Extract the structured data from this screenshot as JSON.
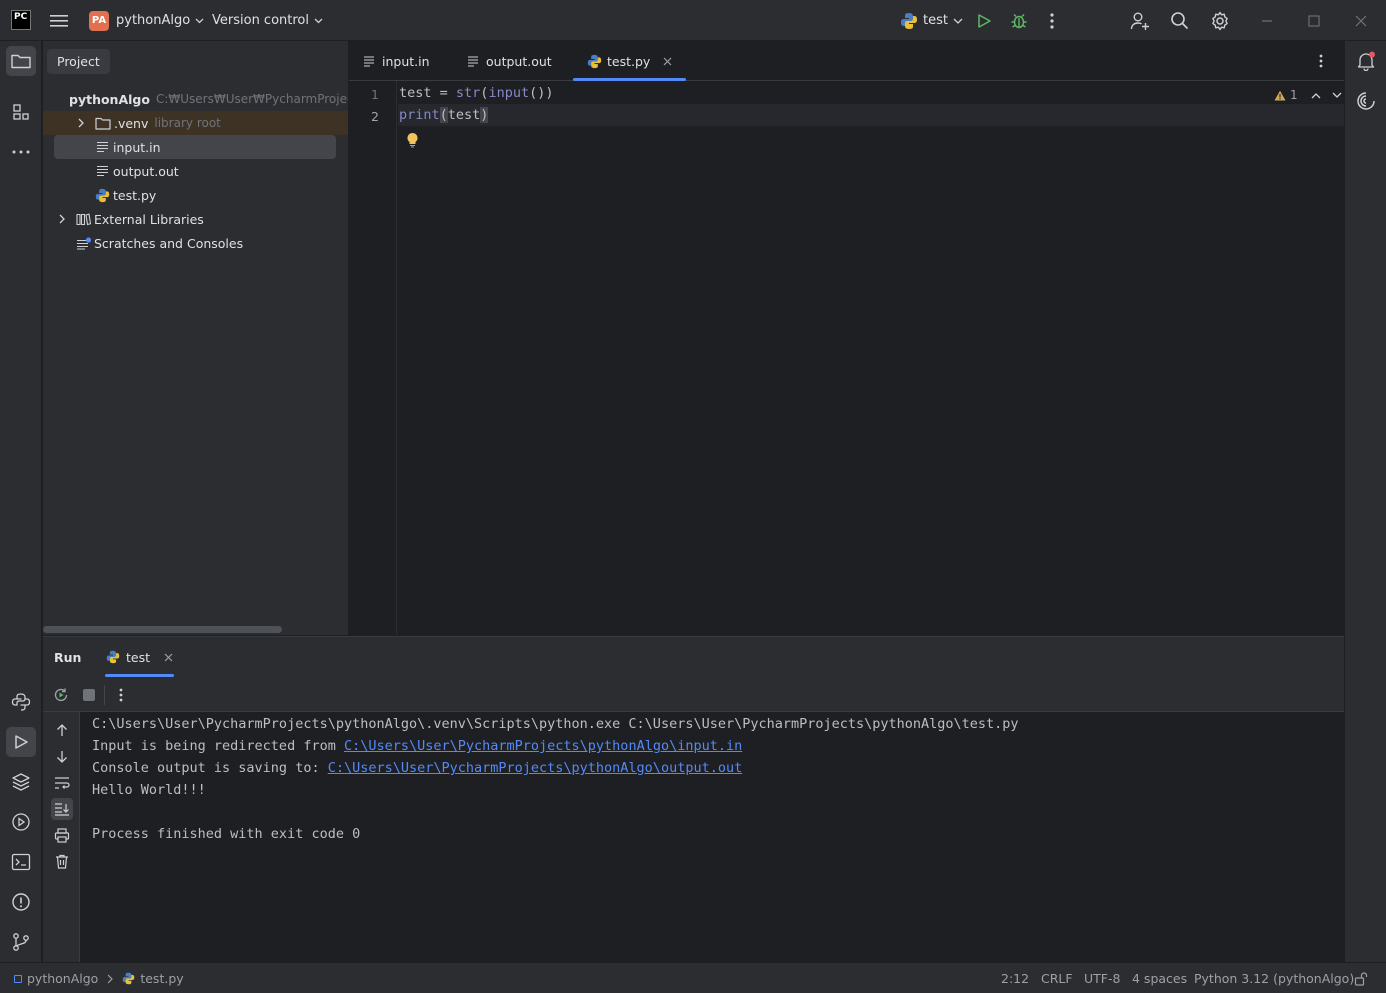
{
  "titlebar": {
    "logo": "PC",
    "project_badge": "PA",
    "project_name": "pythonAlgo",
    "vcs_label": "Version control",
    "run_config": "test",
    "icons": [
      "hamburger-menu-icon",
      "run-icon",
      "debug-icon",
      "more-icon",
      "add-user-icon",
      "search-icon",
      "settings-icon",
      "minimize-icon",
      "maximize-icon",
      "close-icon"
    ]
  },
  "project_panel": {
    "tab_label": "Project",
    "tree": [
      {
        "label": "pythonAlgo",
        "hint": "C:₩Users₩User₩PycharmProjects₩",
        "type": "folder",
        "expanded": true
      },
      {
        "label": ".venv",
        "hint": "library root",
        "type": "folder",
        "expanded": false
      },
      {
        "label": "input.in",
        "hint": "",
        "type": "text-file",
        "selected": true
      },
      {
        "label": "output.out",
        "hint": "",
        "type": "text-file"
      },
      {
        "label": "test.py",
        "hint": "",
        "type": "python-file"
      },
      {
        "label": "External Libraries",
        "hint": "",
        "type": "library"
      },
      {
        "label": "Scratches and Consoles",
        "hint": "",
        "type": "scratches"
      }
    ]
  },
  "editor": {
    "tabs": [
      {
        "label": "input.in",
        "active": false
      },
      {
        "label": "output.out",
        "active": false
      },
      {
        "label": "test.py",
        "active": true
      }
    ],
    "warning_count": "1",
    "line_numbers": [
      "1",
      "2"
    ],
    "lines": [
      {
        "id": "test",
        "sp1": " = ",
        "fn1": "str",
        "p1": "(",
        "fn2": "input",
        "p2": "())"
      },
      {
        "fn1": "print",
        "p1": "(",
        "id": "test",
        "p2": ")"
      }
    ]
  },
  "run_panel": {
    "title": "Run",
    "tab_label": "test",
    "console": {
      "line1": "C:\\Users\\User\\PycharmProjects\\pythonAlgo\\.venv\\Scripts\\python.exe C:\\Users\\User\\PycharmProjects\\pythonAlgo\\test.py",
      "line2_prefix": "Input is being redirected from ",
      "line2_link": "C:\\Users\\User\\PycharmProjects\\pythonAlgo\\input.in",
      "line3_prefix": "Console output is saving to: ",
      "line3_link": "C:\\Users\\User\\PycharmProjects\\pythonAlgo\\output.out",
      "line4": "Hello World!!!",
      "line6": "Process finished with exit code 0"
    }
  },
  "statusbar": {
    "breadcrumb_project": "pythonAlgo",
    "breadcrumb_file": "test.py",
    "position": "2:12",
    "line_separator": "CRLF",
    "encoding": "UTF-8",
    "indent": "4 spaces",
    "interpreter": "Python 3.12 (pythonAlgo)"
  },
  "colors": {
    "background": "#1e1f22",
    "panel": "#2b2d30",
    "accent": "#548af7",
    "run_green": "#5fb865",
    "project_badge": "#e0704f"
  }
}
